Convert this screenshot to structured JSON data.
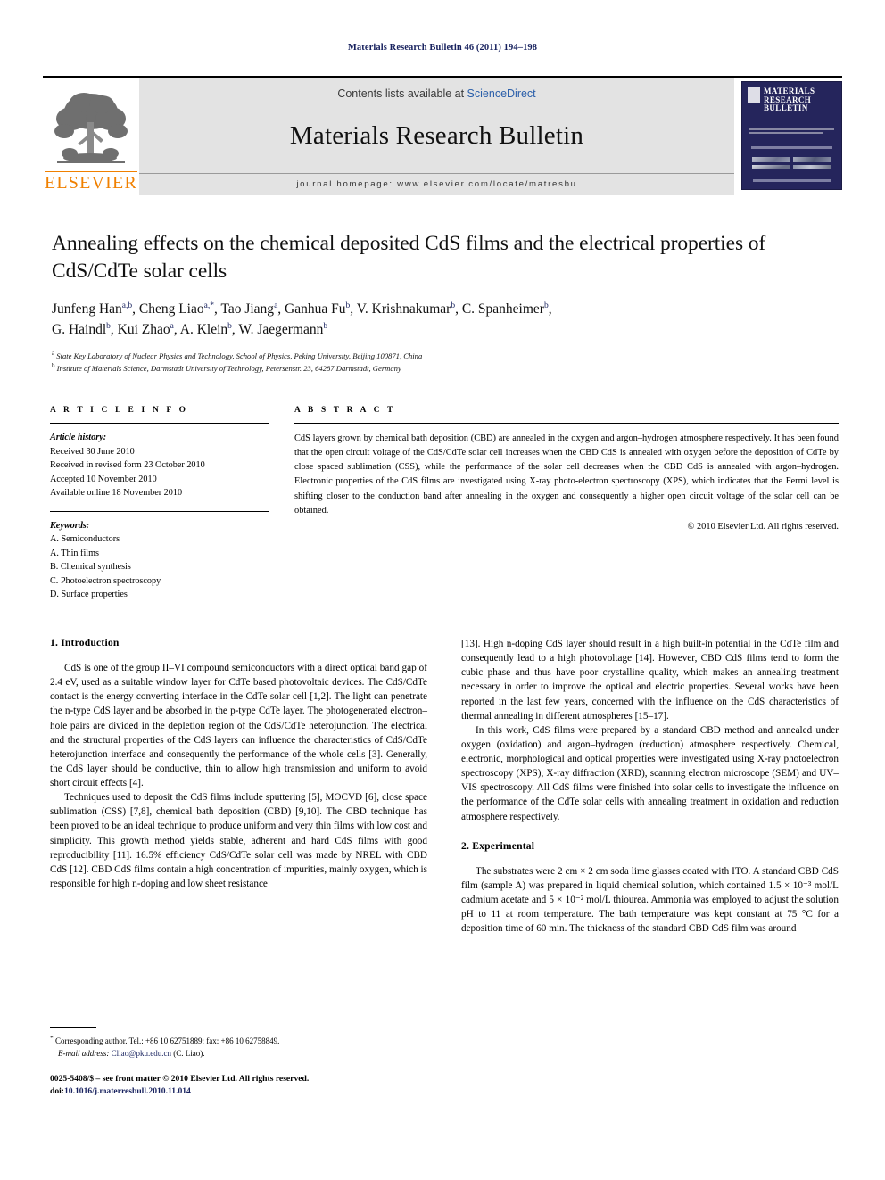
{
  "running_head": "Materials Research Bulletin 46 (2011) 194–198",
  "masthead": {
    "contents_prefix": "Contents lists available at ",
    "sciencedirect": "ScienceDirect",
    "journal_title": "Materials Research Bulletin",
    "homepage": "journal homepage: www.elsevier.com/locate/matresbu",
    "publisher_logo_text": "ELSEVIER",
    "cover_title_line1": "MATERIALS",
    "cover_title_line2": "RESEARCH",
    "cover_title_line3": "BULLETIN",
    "sciencedirect_color": "#2b5faa",
    "elsevier_orange": "#f08000",
    "cover_navy": "#25255c"
  },
  "article": {
    "title": "Annealing effects on the chemical deposited CdS films and the electrical properties of CdS/CdTe solar cells",
    "authors_line1_parts": [
      {
        "name": "Junfeng Han",
        "sup": "a,b",
        "sep": ", "
      },
      {
        "name": "Cheng Liao",
        "sup": "a,*",
        "sep": ", "
      },
      {
        "name": "Tao Jiang",
        "sup": "a",
        "sep": ", "
      },
      {
        "name": "Ganhua Fu",
        "sup": "b",
        "sep": ", "
      },
      {
        "name": "V. Krishnakumar",
        "sup": "b",
        "sep": ", "
      },
      {
        "name": "C. Spanheimer",
        "sup": "b",
        "sep": ","
      }
    ],
    "authors_line2_parts": [
      {
        "name": "G. Haindl",
        "sup": "b",
        "sep": ", "
      },
      {
        "name": "Kui Zhao",
        "sup": "a",
        "sep": ", "
      },
      {
        "name": "A. Klein",
        "sup": "b",
        "sep": ", "
      },
      {
        "name": "W. Jaegermann",
        "sup": "b",
        "sep": ""
      }
    ],
    "affiliation_a_sup": "a",
    "affiliation_a": "State Key Laboratory of Nuclear Physics and Technology, School of Physics, Peking University, Beijing 100871, China",
    "affiliation_b_sup": "b",
    "affiliation_b": "Institute of Materials Science, Darmstadt University of Technology, Petersenstr. 23, 64287 Darmstadt, Germany"
  },
  "article_info": {
    "heading": "A R T I C L E   I N F O",
    "history_label": "Article history:",
    "history": [
      "Received 30 June 2010",
      "Received in revised form 23 October 2010",
      "Accepted 10 November 2010",
      "Available online 18 November 2010"
    ],
    "keywords_label": "Keywords:",
    "keywords": [
      "A. Semiconductors",
      "A. Thin films",
      "B. Chemical synthesis",
      "C. Photoelectron spectroscopy",
      "D. Surface properties"
    ]
  },
  "abstract": {
    "heading": "A B S T R A C T",
    "text": "CdS layers grown by chemical bath deposition (CBD) are annealed in the oxygen and argon–hydrogen atmosphere respectively. It has been found that the open circuit voltage of the CdS/CdTe solar cell increases when the CBD CdS is annealed with oxygen before the deposition of CdTe by close spaced sublimation (CSS), while the performance of the solar cell decreases when the CBD CdS is annealed with argon–hydrogen. Electronic properties of the CdS films are investigated using X-ray photo-electron spectroscopy (XPS), which indicates that the Fermi level is shifting closer to the conduction band after annealing in the oxygen and consequently a higher open circuit voltage of the solar cell can be obtained.",
    "copyright": "© 2010 Elsevier Ltd. All rights reserved."
  },
  "sections": {
    "introduction_heading": "1. Introduction",
    "intro_p1": "CdS is one of the group II–VI compound semiconductors with a direct optical band gap of 2.4 eV, used as a suitable window layer for CdTe based photovoltaic devices. The CdS/CdTe contact is the energy converting interface in the CdTe solar cell [1,2]. The light can penetrate the n-type CdS layer and be absorbed in the p-type CdTe layer. The photogenerated electron–hole pairs are divided in the depletion region of the CdS/CdTe heterojunction. The electrical and the structural properties of the CdS layers can influence the characteristics of CdS/CdTe heterojunction interface and consequently the performance of the whole cells [3]. Generally, the CdS layer should be conductive, thin to allow high transmission and uniform to avoid short circuit effects [4].",
    "intro_p2": "Techniques used to deposit the CdS films include sputtering [5], MOCVD [6], close space sublimation (CSS) [7,8], chemical bath deposition (CBD) [9,10]. The CBD technique has been proved to be an ideal technique to produce uniform and very thin films with low cost and simplicity. This growth method yields stable, adherent and hard CdS films with good reproducibility [11]. 16.5% efficiency CdS/CdTe solar cell was made by NREL with CBD CdS [12]. CBD CdS films contain a high concentration of impurities, mainly oxygen, which is responsible for high n-doping and low sheet resistance",
    "intro_p3": "[13]. High n-doping CdS layer should result in a high built-in potential in the CdTe film and consequently lead to a high photovoltage [14]. However, CBD CdS films tend to form the cubic phase and thus have poor crystalline quality, which makes an annealing treatment necessary in order to improve the optical and electric properties. Several works have been reported in the last few years, concerned with the influence on the CdS characteristics of thermal annealing in different atmospheres [15–17].",
    "intro_p4": "In this work, CdS films were prepared by a standard CBD method and annealed under oxygen (oxidation) and argon–hydrogen (reduction) atmosphere respectively. Chemical, electronic, morphological and optical properties were investigated using X-ray photoelectron spectroscopy (XPS), X-ray diffraction (XRD), scanning electron microscope (SEM) and UV–VIS spectroscopy. All CdS films were finished into solar cells to investigate the influence on the performance of the CdTe solar cells with annealing treatment in oxidation and reduction atmosphere respectively.",
    "experimental_heading": "2. Experimental",
    "exp_p1": "The substrates were 2 cm × 2 cm soda lime glasses coated with ITO. A standard CBD CdS film (sample A) was prepared in liquid chemical solution, which contained 1.5 × 10⁻³ mol/L cadmium acetate and 5 × 10⁻² mol/L thiourea. Ammonia was employed to adjust the solution pH to 11 at room temperature. The bath temperature was kept constant at 75 °C for a deposition time of 60 min. The thickness of the standard CBD CdS film was around"
  },
  "footnote": {
    "marker": "*",
    "text": "Corresponding author. Tel.: +86 10 62751889; fax: +86 10 62758849.",
    "email_label": "E-mail address:",
    "email": "Cliao@pku.edu.cn",
    "email_suffix": " (C. Liao)."
  },
  "publisher_footer": {
    "line1": "0025-5408/$ – see front matter © 2010 Elsevier Ltd. All rights reserved.",
    "doi_label": "doi:",
    "doi": "10.1016/j.materresbull.2010.11.014"
  }
}
